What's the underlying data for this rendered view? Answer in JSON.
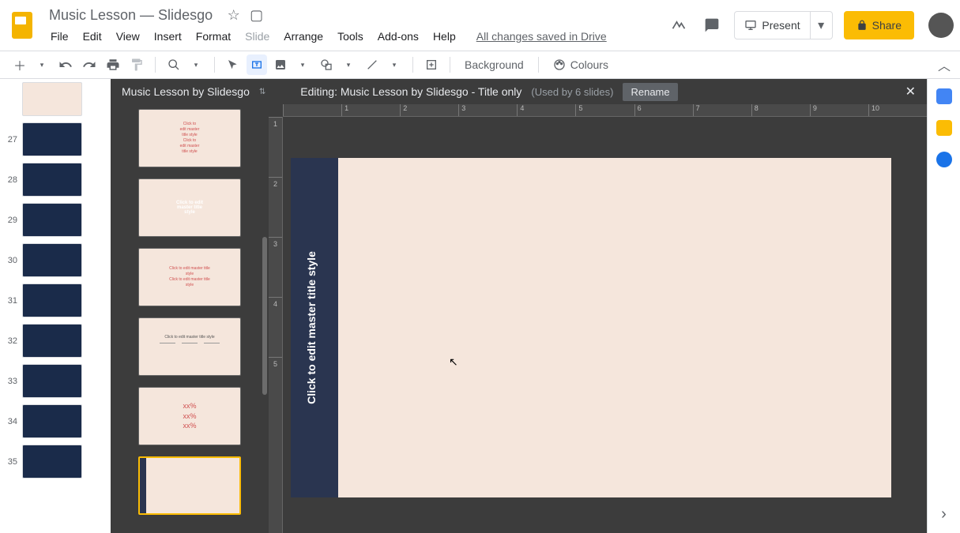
{
  "header": {
    "doc_title": "Music Lesson — Slidesgo",
    "star_icon": "☆",
    "folder_icon": "▢",
    "menus": [
      "File",
      "Edit",
      "View",
      "Insert",
      "Format",
      "Slide",
      "Arrange",
      "Tools",
      "Add-ons",
      "Help"
    ],
    "disabled_menu_index": 5,
    "save_status": "All changes saved in Drive",
    "present": "Present",
    "share": "Share"
  },
  "toolbar": {
    "background": "Background",
    "colours": "Colours"
  },
  "filmstrip": {
    "slides": [
      {
        "num": "",
        "light": true
      },
      {
        "num": "27",
        "light": false
      },
      {
        "num": "28",
        "light": false
      },
      {
        "num": "29",
        "light": false
      },
      {
        "num": "30",
        "light": false
      },
      {
        "num": "31",
        "light": false
      },
      {
        "num": "32",
        "light": false
      },
      {
        "num": "33",
        "light": false
      },
      {
        "num": "34",
        "light": false
      },
      {
        "num": "35",
        "light": false
      }
    ]
  },
  "master": {
    "panel_title": "Music Lesson by Slidesgo",
    "editing_prefix": "Editing: ",
    "editing_name": "Music Lesson by Slidesgo - Title only",
    "used_by": "(Used by 6 slides)",
    "rename": "Rename"
  },
  "layouts": {
    "items": [
      {
        "lines": [
          "Click to",
          "edit master",
          "title style",
          "Click to",
          "edit master",
          "title style"
        ],
        "cls": "lt-text"
      },
      {
        "lines": [
          "Click to edit",
          "master title",
          "style"
        ],
        "cls": "lt-white"
      },
      {
        "lines": [
          "Click to edit master title",
          "style",
          "Click to edit master title",
          "style"
        ],
        "cls": "lt-text"
      },
      {
        "lines": [
          "Click to edit master title style"
        ],
        "cls": "lt-dark",
        "bullets": true
      },
      {
        "lines": [
          "xx%",
          "xx%",
          "xx%"
        ],
        "cls": "lt-text",
        "big": true
      },
      {
        "lines": [
          ""
        ],
        "cls": "lt-text",
        "selected": true,
        "stripe": true
      }
    ]
  },
  "canvas": {
    "vertical_title": "Click to edit master title style",
    "ruler_h": [
      "",
      "1",
      "2",
      "3",
      "4",
      "5",
      "6",
      "7",
      "8",
      "9",
      "10"
    ],
    "ruler_v": [
      "1",
      "2",
      "3",
      "4",
      "5"
    ]
  }
}
